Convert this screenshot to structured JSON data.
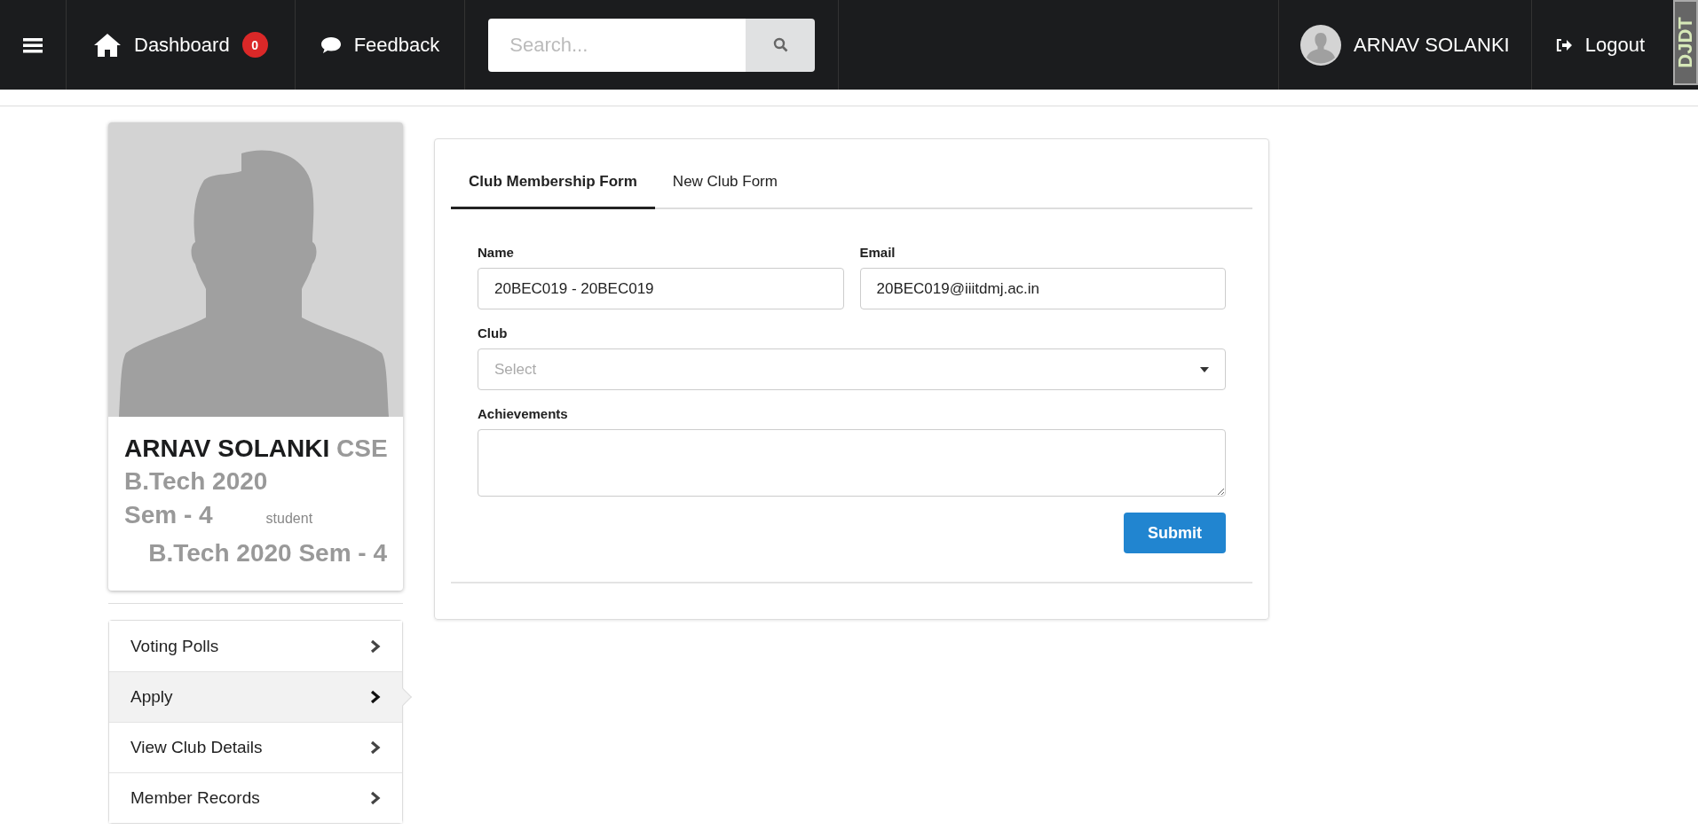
{
  "navbar": {
    "dashboard": {
      "label": "Dashboard",
      "badge": "0"
    },
    "feedback": "Feedback",
    "search": {
      "placeholder": "Search..."
    },
    "user": "ARNAV SOLANKI",
    "logout": "Logout",
    "debug_handle": "DJDT"
  },
  "profile": {
    "name": "ARNAV SOLANKI",
    "department": "CSE",
    "programme": "B.Tech 2020",
    "semester": "Sem - 4",
    "role": "student",
    "summary": "B.Tech 2020 Sem - 4"
  },
  "menu": [
    {
      "label": "Voting Polls",
      "selected": false
    },
    {
      "label": "Apply",
      "selected": true
    },
    {
      "label": "View Club Details",
      "selected": false
    },
    {
      "label": "Member Records",
      "selected": false
    }
  ],
  "tabs": [
    {
      "label": "Club Membership Form",
      "selected": true
    },
    {
      "label": "New Club Form",
      "selected": false
    }
  ],
  "form": {
    "name": {
      "label": "Name",
      "value": "20BEC019 - 20BEC019"
    },
    "email": {
      "label": "Email",
      "value": "20BEC019@iiitdmj.ac.in"
    },
    "club": {
      "label": "Club",
      "placeholder": "Select"
    },
    "achievements": {
      "label": "Achievements"
    },
    "submit": "Submit"
  }
}
